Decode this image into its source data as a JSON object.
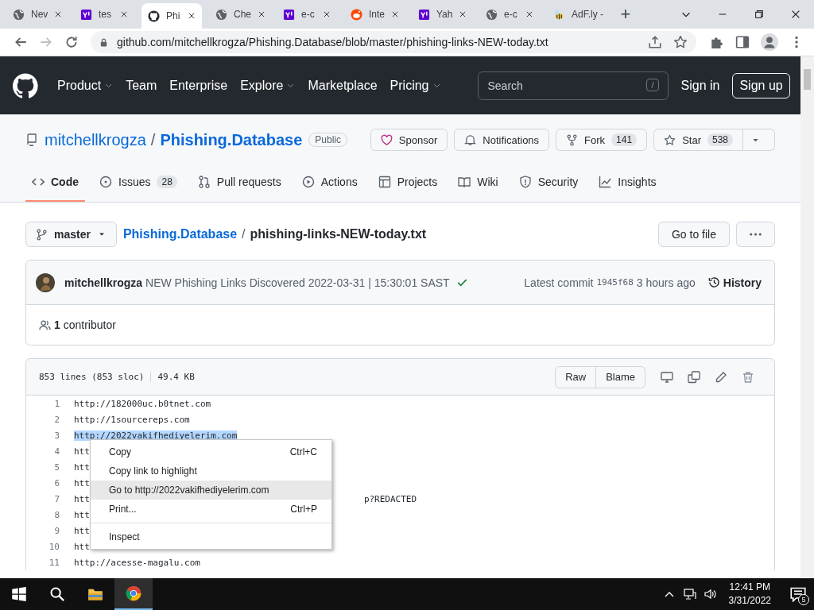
{
  "browser": {
    "tabs": [
      {
        "title": "Nev",
        "kind": "globe",
        "selected": false
      },
      {
        "title": "tes",
        "kind": "yahoo",
        "selected": false
      },
      {
        "title": "Phi",
        "kind": "github",
        "selected": true
      },
      {
        "title": "Che",
        "kind": "globe",
        "selected": false
      },
      {
        "title": "e-c",
        "kind": "yahoo",
        "selected": false
      },
      {
        "title": "Inte",
        "kind": "reddit",
        "selected": false
      },
      {
        "title": "Yah",
        "kind": "yahoo",
        "selected": false
      },
      {
        "title": "e-c",
        "kind": "globe",
        "selected": false
      },
      {
        "title": "AdF.ly -",
        "kind": "bee",
        "selected": false
      }
    ],
    "new_tab": "+",
    "address": "github.com/mitchellkrogza/Phishing.Database/blob/master/phishing-links-NEW-today.txt"
  },
  "header": {
    "nav": [
      {
        "label": "Product",
        "dropdown": true
      },
      {
        "label": "Team",
        "dropdown": false
      },
      {
        "label": "Enterprise",
        "dropdown": false
      },
      {
        "label": "Explore",
        "dropdown": true
      },
      {
        "label": "Marketplace",
        "dropdown": false
      },
      {
        "label": "Pricing",
        "dropdown": true
      }
    ],
    "search": {
      "placeholder": "Search",
      "shortcut": "/"
    },
    "sign_in": "Sign in",
    "sign_up": "Sign up"
  },
  "repo": {
    "owner": "mitchellkrogza",
    "separator": "/",
    "name": "Phishing.Database",
    "visibility": "Public",
    "actions": [
      {
        "label": "Sponsor",
        "kind": "sponsor"
      },
      {
        "label": "Notifications",
        "kind": "bell"
      },
      {
        "label": "Fork",
        "count": "141",
        "kind": "fork"
      },
      {
        "label": "Star",
        "count": "538",
        "kind": "star"
      }
    ]
  },
  "tabs": [
    {
      "label": "Code",
      "kind": "code",
      "selected": true
    },
    {
      "label": "Issues",
      "count": "28",
      "kind": "issue",
      "selected": false
    },
    {
      "label": "Pull requests",
      "kind": "pr",
      "selected": false
    },
    {
      "label": "Actions",
      "kind": "play",
      "selected": false
    },
    {
      "label": "Projects",
      "kind": "table",
      "selected": false
    },
    {
      "label": "Wiki",
      "kind": "book",
      "selected": false
    },
    {
      "label": "Security",
      "kind": "shield",
      "selected": false
    },
    {
      "label": "Insights",
      "kind": "graph",
      "selected": false
    }
  ],
  "file_nav": {
    "branch": "master",
    "repo_link": "Phishing.Database",
    "separator": "/",
    "file": "phishing-links-NEW-today.txt",
    "go_to_file": "Go to file"
  },
  "commit": {
    "author": "mitchellkrogza",
    "message": "NEW Phishing Links Discovered 2022-03-31 | 15:30:01 SAST",
    "latest_label": "Latest commit",
    "sha": "1945f68",
    "age": "3 hours ago",
    "history": "History",
    "contributors": "**1** contributor"
  },
  "file": {
    "lines_info": "853 lines (853 sloc)",
    "size": "49.4 KB",
    "buttons": [
      "Raw",
      "Blame"
    ],
    "lines": [
      {
        "number": "1",
        "text": "http://182000uc.b0tnet.com",
        "selected": false
      },
      {
        "number": "2",
        "text": "http://1sourcereps.com",
        "selected": false
      },
      {
        "number": "3",
        "text": "http://2022vakifhediyelerim.com",
        "selected": true
      },
      {
        "number": "4",
        "text": "htt",
        "selected": false
      },
      {
        "number": "5",
        "text": "htt",
        "selected": false
      },
      {
        "number": "6",
        "text": "htt",
        "selected": false
      },
      {
        "number": "7",
        "text": "htt",
        "tail": "p?REDACTED",
        "selected": false
      },
      {
        "number": "8",
        "text": "htt",
        "selected": false
      },
      {
        "number": "9",
        "text": "htt",
        "selected": false
      },
      {
        "number": "10",
        "text": "htt",
        "selected": false
      },
      {
        "number": "11",
        "text": "http://acesse-magalu.com",
        "selected": false
      }
    ]
  },
  "context_menu": {
    "items": [
      {
        "kind": "item",
        "label": "Copy",
        "shortcut": "Ctrl+C",
        "selected": false
      },
      {
        "kind": "item",
        "label": "Copy link to highlight",
        "selected": false
      },
      {
        "kind": "item",
        "label": "Go to http://2022vakifhediyelerim.com",
        "selected": true
      },
      {
        "kind": "item",
        "label": "Print...",
        "shortcut": "Ctrl+P",
        "selected": false
      },
      {
        "kind": "separator"
      },
      {
        "kind": "item",
        "label": "Inspect",
        "selected": false
      }
    ]
  },
  "taskbar": {
    "time": "12:41 PM",
    "date": "3/31/2022",
    "notifications": "5"
  }
}
